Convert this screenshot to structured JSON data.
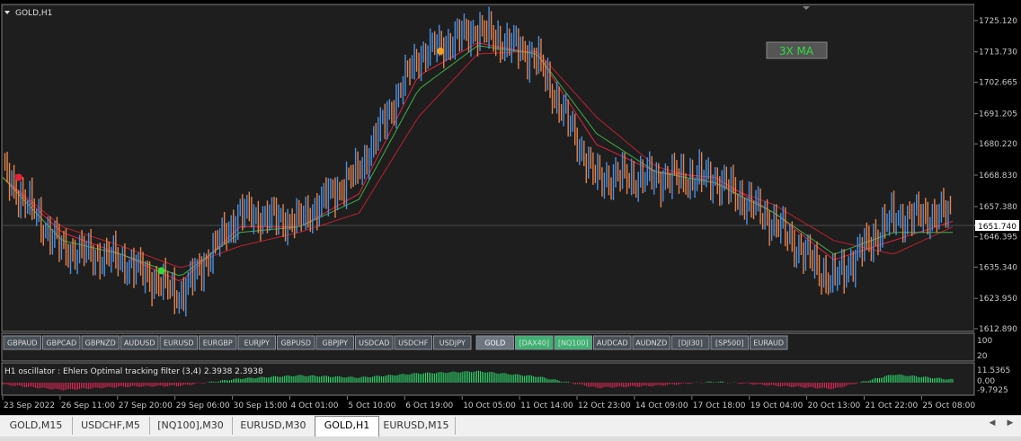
{
  "window": {
    "symbol_label": "GOLD,H1"
  },
  "ma_button": {
    "label": "3X MA"
  },
  "price_axis": {
    "labels": [
      "1725.120",
      "1713.730",
      "1702.665",
      "1691.205",
      "1680.220",
      "1668.830",
      "1657.380",
      "1646.395",
      "1635.340",
      "1623.950",
      "1612.890"
    ],
    "current_price": "1651.740"
  },
  "symbol_buttons": [
    {
      "label": "GBPAUD",
      "state": "normal"
    },
    {
      "label": "GBPCAD",
      "state": "normal"
    },
    {
      "label": "GBPNZD",
      "state": "normal"
    },
    {
      "label": "AUDUSD",
      "state": "normal"
    },
    {
      "label": "EURUSD",
      "state": "normal"
    },
    {
      "label": "EURGBP",
      "state": "normal"
    },
    {
      "label": "EURJPY",
      "state": "normal"
    },
    {
      "label": "GBPUSD",
      "state": "normal"
    },
    {
      "label": "GBPJPY",
      "state": "normal"
    },
    {
      "label": "USDCAD",
      "state": "normal"
    },
    {
      "label": "USDCHF",
      "state": "normal"
    },
    {
      "label": "USDJPY",
      "state": "normal"
    },
    {
      "label": "GOLD",
      "state": "active"
    },
    {
      "label": "[DAX40]",
      "state": "green"
    },
    {
      "label": "[NQ100]",
      "state": "green"
    },
    {
      "label": "AUDCAD",
      "state": "normal"
    },
    {
      "label": "AUDNZD",
      "state": "normal"
    },
    {
      "label": "[DJI30]",
      "state": "normal"
    },
    {
      "label": "[SP500]",
      "state": "normal"
    },
    {
      "label": "EURAUD",
      "state": "normal"
    }
  ],
  "button_panel_axis": [
    "100",
    "20"
  ],
  "oscillator": {
    "label": "H1  oscillator : Ehlers Optimal tracking filter (3,4)  2.3938 2.3938",
    "axis_labels": [
      "11.5365",
      "0.00",
      "-9.7925"
    ]
  },
  "time_axis": [
    "23 Sep 2022",
    "26 Sep 11:00",
    "27 Sep 20:00",
    "29 Sep 06:00",
    "30 Sep 15:00",
    "4 Oct 01:00",
    "5 Oct 10:00",
    "6 Oct 19:00",
    "10 Oct 05:00",
    "11 Oct 14:00",
    "12 Oct 23:00",
    "14 Oct 09:00",
    "17 Oct 18:00",
    "19 Oct 04:00",
    "20 Oct 13:00",
    "21 Oct 22:00",
    "25 Oct 08:00"
  ],
  "tabs": [
    "GOLD,M15",
    "USDCHF,M5",
    "[NQ100],M30",
    "EURUSD,M30",
    "GOLD,H1",
    "EURUSD,M15"
  ],
  "active_tab": "GOLD,H1",
  "colors": {
    "background": "#000000",
    "chart_panel": "#1e1e1e",
    "bull_candle": "#4a90e2",
    "bear_candle": "#e8824a",
    "ma_fast": "#e82040",
    "ma_slow": "#c02030",
    "ma_trend": "#3cb044",
    "osc_positive": "#30e070",
    "osc_negative": "#e8285a",
    "button_green": "#3cb371",
    "button_normal": "#4a5058"
  },
  "chart_data": {
    "type": "line",
    "title": "GOLD,H1",
    "xlabel": "",
    "ylabel": "",
    "ylim": [
      1612.89,
      1730.0
    ],
    "x": [
      "23 Sep 2022",
      "26 Sep 11:00",
      "27 Sep 20:00",
      "29 Sep 06:00",
      "30 Sep 15:00",
      "4 Oct 01:00",
      "5 Oct 10:00",
      "6 Oct 19:00",
      "10 Oct 05:00",
      "11 Oct 14:00",
      "12 Oct 23:00",
      "14 Oct 09:00",
      "17 Oct 18:00",
      "19 Oct 04:00",
      "20 Oct 13:00",
      "21 Oct 22:00",
      "25 Oct 08:00"
    ],
    "series": [
      {
        "values": [
          1670,
          1642,
          1638,
          1625,
          1655,
          1652,
          1670,
          1712,
          1722,
          1712,
          1668,
          1668,
          1668,
          1652,
          1630,
          1653,
          1655
        ]
      },
      {
        "values": [
          1668,
          1648,
          1640,
          1630,
          1650,
          1650,
          1662,
          1705,
          1717,
          1713,
          1680,
          1670,
          1668,
          1655,
          1638,
          1645,
          1652
        ]
      },
      {
        "values": [
          1668,
          1650,
          1643,
          1635,
          1643,
          1648,
          1655,
          1690,
          1713,
          1714,
          1690,
          1672,
          1666,
          1658,
          1645,
          1640,
          1650
        ]
      },
      {
        "values": [
          1668,
          1645,
          1640,
          1632,
          1648,
          1650,
          1660,
          1700,
          1716,
          1713,
          1684,
          1670,
          1666,
          1655,
          1640,
          1648,
          1648
        ]
      }
    ],
    "oscillator_values": [
      -2,
      -7,
      -4,
      -3,
      4,
      7,
      5,
      9,
      11,
      6,
      -5,
      -3,
      1,
      -3,
      -6,
      8,
      3
    ],
    "current_price": 1651.74,
    "legend": "none",
    "grid": false
  }
}
